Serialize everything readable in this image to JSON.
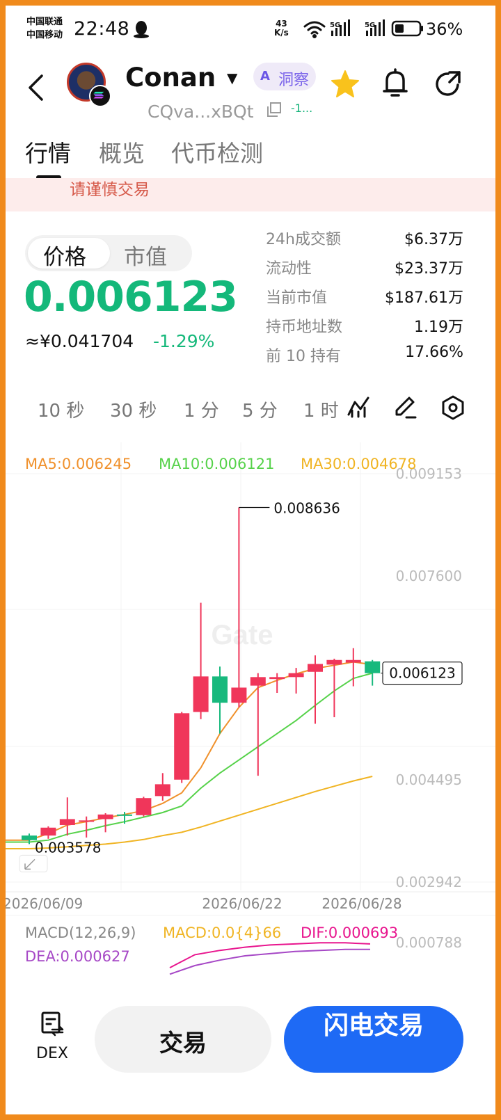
{
  "status_bar": {
    "carrier1": "中国联通",
    "carrier2": "中国移动",
    "time": "22:48",
    "speed_value": "43",
    "speed_unit": "K/s",
    "signal1": "5G",
    "signal2": "5G",
    "battery": "36%"
  },
  "header": {
    "token_name": "Conan",
    "ai_label": "洞察",
    "ai_logo": "A",
    "address": "CQva...xBQt",
    "address_change": "-1..."
  },
  "tabs": [
    "行情",
    "概览",
    "代币检测"
  ],
  "warning": "请谨慎交易",
  "price": {
    "toggle_price": "价格",
    "toggle_mcap": "市值",
    "value": "0.006123",
    "cny": "≈¥0.041704",
    "change": "-1.29%"
  },
  "stats": [
    {
      "label": "24h成交额",
      "value": "$6.37万"
    },
    {
      "label": "流动性",
      "value": "$23.37万"
    },
    {
      "label": "当前市值",
      "value": "$187.61万"
    },
    {
      "label": "持币地址数",
      "value": "1.19万"
    },
    {
      "label": "前 10 持有",
      "value": "17.66%"
    }
  ],
  "intervals": [
    "10 秒",
    "30 秒",
    "1 分",
    "5 分",
    "1 时"
  ],
  "chart": {
    "ma5": "MA5:0.006245",
    "ma10": "MA10:0.006121",
    "ma30": "MA30:0.004678",
    "watermark": "Gate",
    "y_labels": [
      "0.009153",
      "0.007600",
      "0.004495",
      "0.002942"
    ],
    "x_labels": [
      "2026/06/09",
      "2026/06/22",
      "2026/06/28"
    ],
    "high_label": "0.008636",
    "low_label": "0.003578",
    "current_label": "0.006123",
    "macd_params": "MACD(12,26,9)",
    "macd_value": "MACD:0.0{4}66",
    "dif": "DIF:0.000693",
    "dea": "DEA:0.000627",
    "macd_axis": "0.000788",
    "colors": {
      "up": "#f0365a",
      "down": "#18b97d",
      "ma5": "#f0912c",
      "ma10": "#56d24a",
      "ma30": "#f0b423",
      "dif": "#e8158e",
      "dea": "#a648c6"
    }
  },
  "chart_data": {
    "type": "candlestick",
    "ylim": [
      0.002942,
      0.009153
    ],
    "x_ticks": [
      "2026/06/09",
      "2026/06/22",
      "2026/06/28"
    ],
    "candles": [
      {
        "o": 0.00365,
        "c": 0.00358,
        "h": 0.00368,
        "l": 0.00352
      },
      {
        "o": 0.00365,
        "c": 0.00377,
        "h": 0.00379,
        "l": 0.0036
      },
      {
        "o": 0.00381,
        "c": 0.0039,
        "h": 0.00423,
        "l": 0.00365
      },
      {
        "o": 0.00387,
        "c": 0.00388,
        "h": 0.00394,
        "l": 0.00362
      },
      {
        "o": 0.0039,
        "c": 0.00397,
        "h": 0.00399,
        "l": 0.0037
      },
      {
        "o": 0.00397,
        "c": 0.00396,
        "h": 0.00401,
        "l": 0.00383
      },
      {
        "o": 0.00396,
        "c": 0.00422,
        "h": 0.00424,
        "l": 0.00394
      },
      {
        "o": 0.00425,
        "c": 0.00443,
        "h": 0.0046,
        "l": 0.00418
      },
      {
        "o": 0.0045,
        "c": 0.00551,
        "h": 0.00553,
        "l": 0.00445
      },
      {
        "o": 0.00553,
        "c": 0.00607,
        "h": 0.00719,
        "l": 0.00542
      },
      {
        "o": 0.00607,
        "c": 0.00567,
        "h": 0.00622,
        "l": 0.0052
      },
      {
        "o": 0.00567,
        "c": 0.0059,
        "h": 0.00864,
        "l": 0.0056
      },
      {
        "o": 0.00593,
        "c": 0.00606,
        "h": 0.00612,
        "l": 0.00456
      },
      {
        "o": 0.00603,
        "c": 0.00606,
        "h": 0.00612,
        "l": 0.00582
      },
      {
        "o": 0.00606,
        "c": 0.00612,
        "h": 0.0062,
        "l": 0.00581
      },
      {
        "o": 0.00614,
        "c": 0.00626,
        "h": 0.00639,
        "l": 0.00535
      },
      {
        "o": 0.00625,
        "c": 0.00632,
        "h": 0.00634,
        "l": 0.00545
      },
      {
        "o": 0.00628,
        "c": 0.00632,
        "h": 0.0065,
        "l": 0.00592
      },
      {
        "o": 0.0063,
        "c": 0.00612,
        "h": 0.00632,
        "l": 0.00593
      }
    ],
    "ma5": [
      0.00358,
      0.00368,
      0.00381,
      0.00386,
      0.00392,
      0.00397,
      0.00403,
      0.00414,
      0.0043,
      0.00468,
      0.0052,
      0.0056,
      0.0059,
      0.00601,
      0.00611,
      0.00619,
      0.00624,
      0.00629,
      0.00625
    ],
    "ma10": [
      0.00355,
      0.00358,
      0.00367,
      0.00373,
      0.0038,
      0.00386,
      0.00393,
      0.004,
      0.0041,
      0.00437,
      0.0046,
      0.0048,
      0.005,
      0.0052,
      0.0054,
      0.00563,
      0.00585,
      0.00604,
      0.00612
    ],
    "ma30": [
      0.00345,
      0.00346,
      0.00348,
      0.0035,
      0.00352,
      0.00355,
      0.00359,
      0.00365,
      0.0037,
      0.00378,
      0.00387,
      0.00396,
      0.00405,
      0.00414,
      0.00423,
      0.00432,
      0.0044,
      0.00448,
      0.00455
    ],
    "macd_dif": [
      0.00046,
      0.00058,
      0.00062,
      0.00065,
      0.00067,
      0.00068,
      0.00069,
      0.00069,
      0.00068
    ],
    "macd_dea": [
      0.0004,
      0.00048,
      0.00053,
      0.00057,
      0.00059,
      0.00061,
      0.00062,
      0.00063,
      0.00063
    ]
  },
  "bottom": {
    "dex": "DEX",
    "trade": "交易",
    "flash": "闪电交易"
  }
}
